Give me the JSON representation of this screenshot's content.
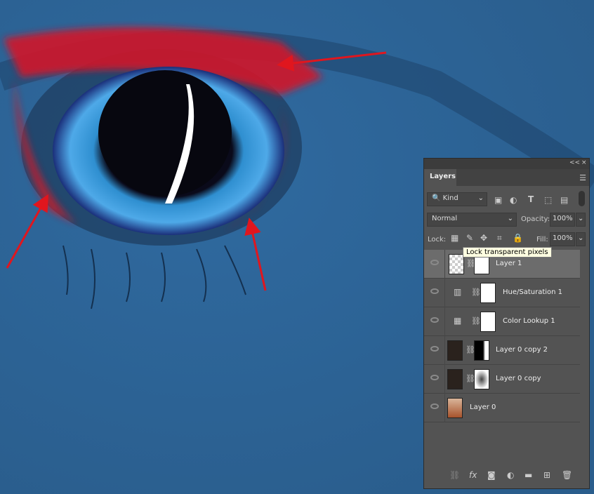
{
  "panel": {
    "collapse": "<<",
    "close": "×",
    "tab": "Layers",
    "menu_icon": "hamburger-icon",
    "filter": {
      "kind": "Kind"
    },
    "blend_mode": "Normal",
    "opacity_label": "Opacity:",
    "opacity": "100%",
    "lock_label": "Lock:",
    "fill_label": "Fill:",
    "fill": "100%",
    "tooltip": "Lock transparent pixels",
    "layers": [
      {
        "name": "Layer 1",
        "selected": true
      },
      {
        "name": "Hue/Saturation 1"
      },
      {
        "name": "Color Lookup 1"
      },
      {
        "name": "Layer 0 copy 2"
      },
      {
        "name": "Layer 0 copy"
      },
      {
        "name": "Layer 0"
      }
    ],
    "fx": "fx"
  },
  "colors": {
    "annotation": "#e0161e",
    "panel": "#535353",
    "canvas": "#2f6595"
  }
}
